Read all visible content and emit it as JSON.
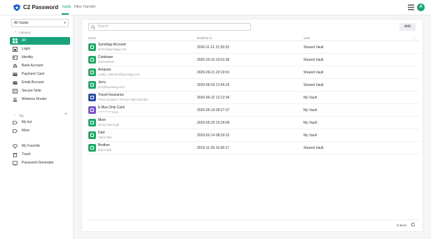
{
  "header": {
    "app_title": "C2 Password",
    "tabs": [
      "Vaults",
      "Files Transfer"
    ],
    "avatar_initial": "A",
    "brand_color": "#1aa37a"
  },
  "sidebar": {
    "vault_select": "All Vaults",
    "category_heading": "Category",
    "categories": [
      {
        "label": "All",
        "icon": "grid-icon",
        "active": true
      },
      {
        "label": "Login",
        "icon": "login-icon"
      },
      {
        "label": "Identity",
        "icon": "identity-icon"
      },
      {
        "label": "Bank Account",
        "icon": "bank-icon"
      },
      {
        "label": "Payment Card",
        "icon": "card-icon"
      },
      {
        "label": "Email Account",
        "icon": "email-icon"
      },
      {
        "label": "Secure Note",
        "icon": "note-icon"
      },
      {
        "label": "Wireless Router",
        "icon": "router-icon"
      }
    ],
    "tag_heading": "Tag",
    "tags": [
      {
        "label": "My list",
        "icon": "tag-icon"
      },
      {
        "label": "Mom",
        "icon": "tag-icon"
      }
    ],
    "bottom": [
      {
        "label": "My Favorite",
        "icon": "heart-icon"
      },
      {
        "label": "Trash",
        "icon": "trash-icon"
      },
      {
        "label": "Password Generator",
        "icon": "generator-icon"
      }
    ]
  },
  "main": {
    "search_placeholder": "Search",
    "add_label": "Add",
    "columns": [
      "Name",
      "Modified at",
      "Vault"
    ],
    "rows": [
      {
        "name": "Synology Account",
        "sub": "derrin@synology.com",
        "date": "2020-11-21 21:30:33",
        "vault": "Shared Vault",
        "color": "#22a86b"
      },
      {
        "name": "Coinbase",
        "sub": "0912322320",
        "date": "2020-10-10 10:01:36",
        "vault": "Shared Vault",
        "color": "#22a86b"
      },
      {
        "name": "Amazon",
        "sub": "mattia_coleman@synology.com",
        "date": "2020-09-21 20:19:01",
        "vault": "Shared Vault",
        "color": "#22a86b"
      },
      {
        "name": "Jerry",
        "sub": "jerry@synology.com",
        "date": "2020-06-03 21:45:19",
        "vault": "Shared Vault",
        "color": "#22a86b"
      },
      {
        "name": "Travel Insurance",
        "sub": "Policy Number: ATF11H Flight Number",
        "date": "2020-06-22 12:12:34",
        "vault": "My Vault",
        "color": "#2f4fa3"
      },
      {
        "name": "E-Bus Only Card",
        "sub": "************1234",
        "date": "2020-05-19 09:27:37",
        "vault": "My Vault",
        "color": "#7b55c7"
      },
      {
        "name": "Mom",
        "sub": "Jenny Murrough",
        "date": "2020-05-20 15:24:09",
        "vault": "My Vault",
        "color": "#22a86b"
      },
      {
        "name": "Dad",
        "sub": "Tyson Birk",
        "date": "2020-02-14 08:30:12",
        "vault": "My Vault",
        "color": "#22a86b"
      },
      {
        "name": "Brother",
        "sub": "Bryce Birk",
        "date": "2019-11-29 10:36:17",
        "vault": "Shared Vault",
        "color": "#22a86b"
      }
    ],
    "item_count": "9 items"
  }
}
